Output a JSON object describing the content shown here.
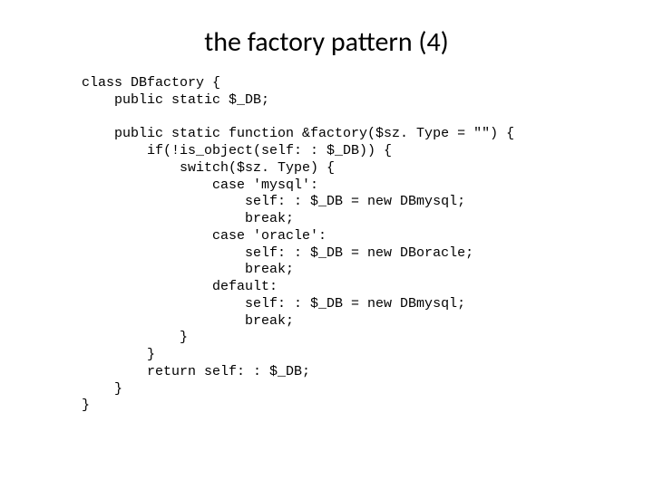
{
  "title": "the factory pattern (4)",
  "code": {
    "lines": [
      "class DBfactory {",
      "    public static $_DB;",
      "",
      "    public static function &factory($sz. Type = \"\") {",
      "        if(!is_object(self: : $_DB)) {",
      "            switch($sz. Type) {",
      "                case 'mysql':",
      "                    self: : $_DB = new DBmysql;",
      "                    break;",
      "                case 'oracle':",
      "                    self: : $_DB = new DBoracle;",
      "                    break;",
      "                default:",
      "                    self: : $_DB = new DBmysql;",
      "                    break;",
      "            }",
      "        }",
      "        return self: : $_DB;",
      "    }",
      "}"
    ]
  }
}
